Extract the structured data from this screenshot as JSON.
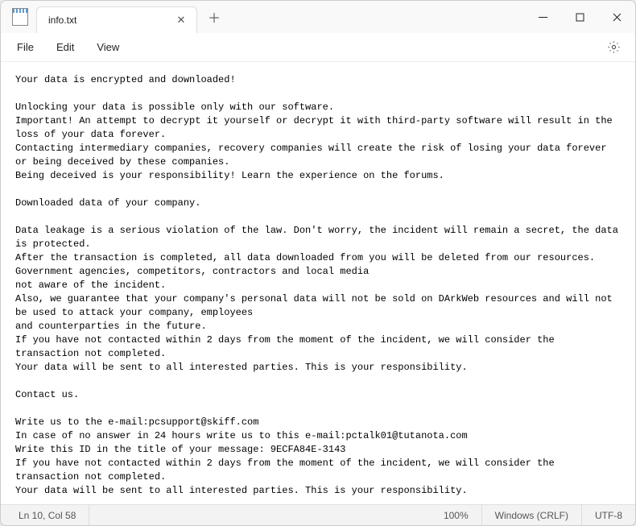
{
  "titlebar": {
    "tab_title": "info.txt"
  },
  "menubar": {
    "file": "File",
    "edit": "Edit",
    "view": "View"
  },
  "content": {
    "text": "Your data is encrypted and downloaded!\n\nUnlocking your data is possible only with our software.\nImportant! An attempt to decrypt it yourself or decrypt it with third-party software will result in the loss of your data forever.\nContacting intermediary companies, recovery companies will create the risk of losing your data forever or being deceived by these companies.\nBeing deceived is your responsibility! Learn the experience on the forums.\n\nDownloaded data of your company.\n\nData leakage is a serious violation of the law. Don't worry, the incident will remain a secret, the data is protected.\nAfter the transaction is completed, all data downloaded from you will be deleted from our resources. Government agencies, competitors, contractors and local media\nnot aware of the incident.\nAlso, we guarantee that your company's personal data will not be sold on DArkWeb resources and will not be used to attack your company, employees\nand counterparties in the future.\nIf you have not contacted within 2 days from the moment of the incident, we will consider the transaction not completed.\nYour data will be sent to all interested parties. This is your responsibility.\n\nContact us.\n\nWrite us to the e-mail:pcsupport@skiff.com\nIn case of no answer in 24 hours write us to this e-mail:pctalk01@tutanota.com\nWrite this ID in the title of your message: 9ECFA84E-3143\nIf you have not contacted within 2 days from the moment of the incident, we will consider the transaction not completed.\nYour data will be sent to all interested parties. This is your responsibility."
  },
  "statusbar": {
    "position": "Ln 10, Col 58",
    "zoom": "100%",
    "line_ending": "Windows (CRLF)",
    "encoding": "UTF-8"
  }
}
